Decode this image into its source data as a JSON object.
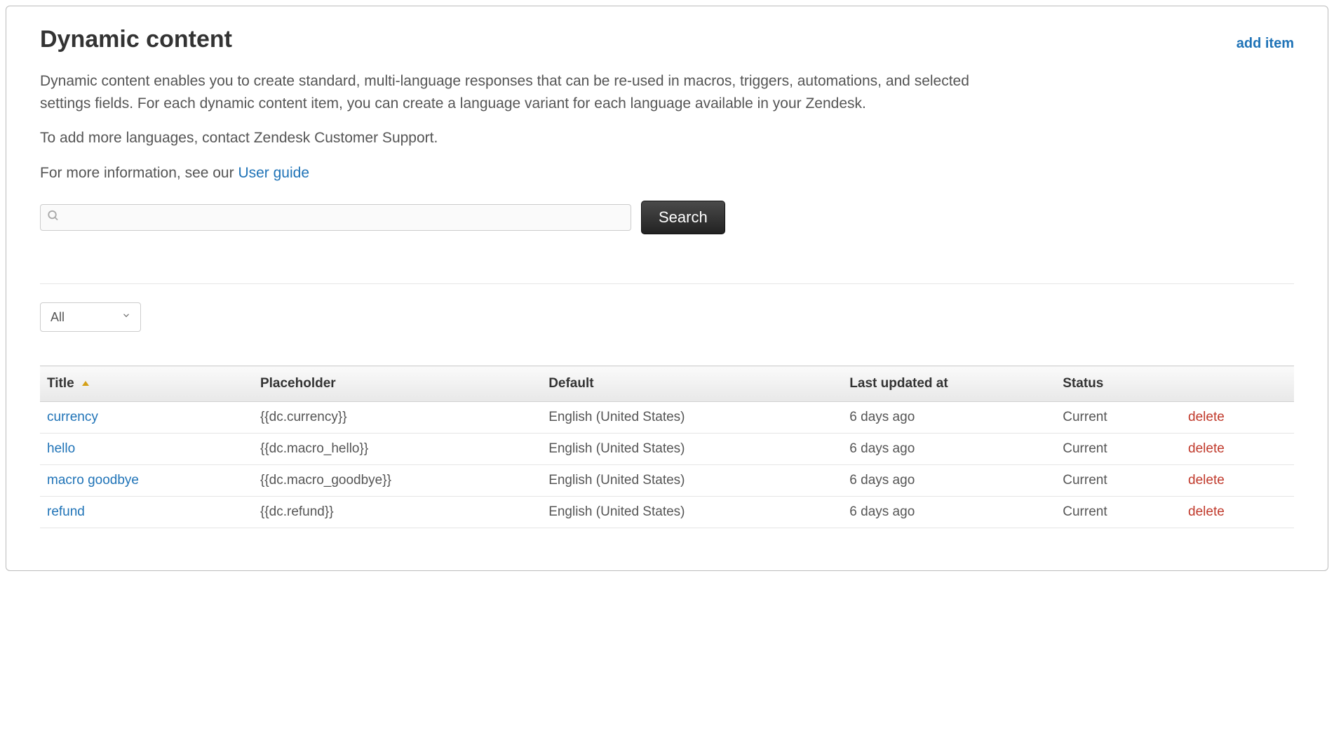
{
  "header": {
    "title": "Dynamic content",
    "add_item_label": "add item"
  },
  "description": {
    "para1": "Dynamic content enables you to create standard, multi-language responses that can be re-used in macros, triggers, automations, and selected settings fields. For each dynamic content item, you can create a language variant for each language available in your Zendesk.",
    "para2": "To add more languages, contact Zendesk Customer Support.",
    "para3_prefix": "For more information, see our ",
    "para3_link": "User guide"
  },
  "search": {
    "placeholder": "",
    "button_label": "Search"
  },
  "filter": {
    "selected": "All"
  },
  "table": {
    "headers": {
      "title": "Title",
      "placeholder": "Placeholder",
      "default": "Default",
      "last_updated": "Last updated at",
      "status": "Status"
    },
    "rows": [
      {
        "title": "currency",
        "placeholder": "{{dc.currency}}",
        "default": "English (United States)",
        "last_updated": "6 days ago",
        "status": "Current",
        "action": "delete"
      },
      {
        "title": "hello",
        "placeholder": "{{dc.macro_hello}}",
        "default": "English (United States)",
        "last_updated": "6 days ago",
        "status": "Current",
        "action": "delete"
      },
      {
        "title": "macro goodbye",
        "placeholder": "{{dc.macro_goodbye}}",
        "default": "English (United States)",
        "last_updated": "6 days ago",
        "status": "Current",
        "action": "delete"
      },
      {
        "title": "refund",
        "placeholder": "{{dc.refund}}",
        "default": "English (United States)",
        "last_updated": "6 days ago",
        "status": "Current",
        "action": "delete"
      }
    ]
  }
}
